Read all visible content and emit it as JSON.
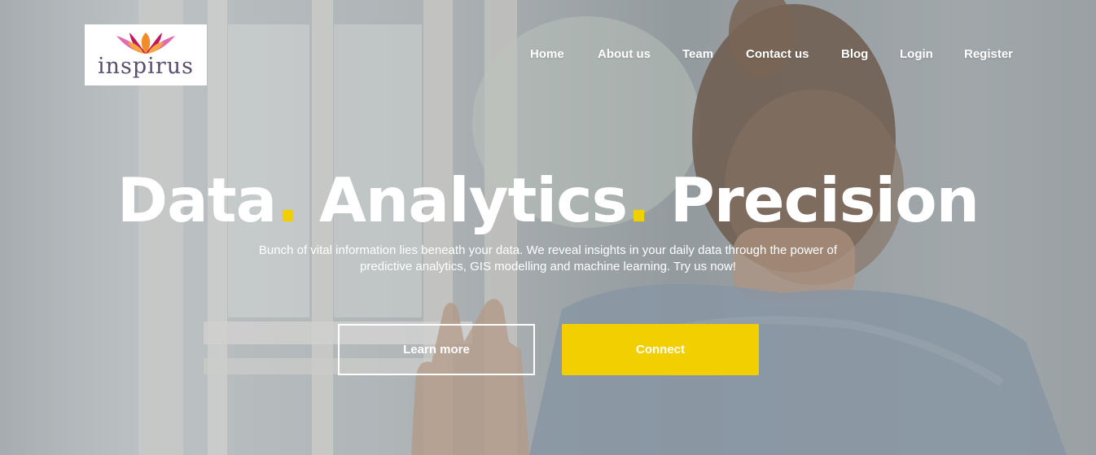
{
  "brand": {
    "logo_text": "inspirus"
  },
  "nav": {
    "items": [
      "Home",
      "About us",
      "Team",
      "Contact us",
      "Blog",
      "Login",
      "Register"
    ]
  },
  "hero": {
    "headline_words": [
      "Data",
      "Analytics",
      "Precision"
    ],
    "headline_separator": ".",
    "subtitle_line1": "Bunch of vital information lies beneath your data. We reveal insights in your daily data through the power of",
    "subtitle_line2": "predictive analytics, GIS modelling and machine learning. Try us now!",
    "primary_button": "Learn more",
    "secondary_button": "Connect"
  },
  "colors": {
    "accent": "#f2cf00",
    "text": "#ffffff",
    "logo_text": "#5a4f6e"
  },
  "icons": {
    "logo_mark": "lotus-flower-icon"
  }
}
